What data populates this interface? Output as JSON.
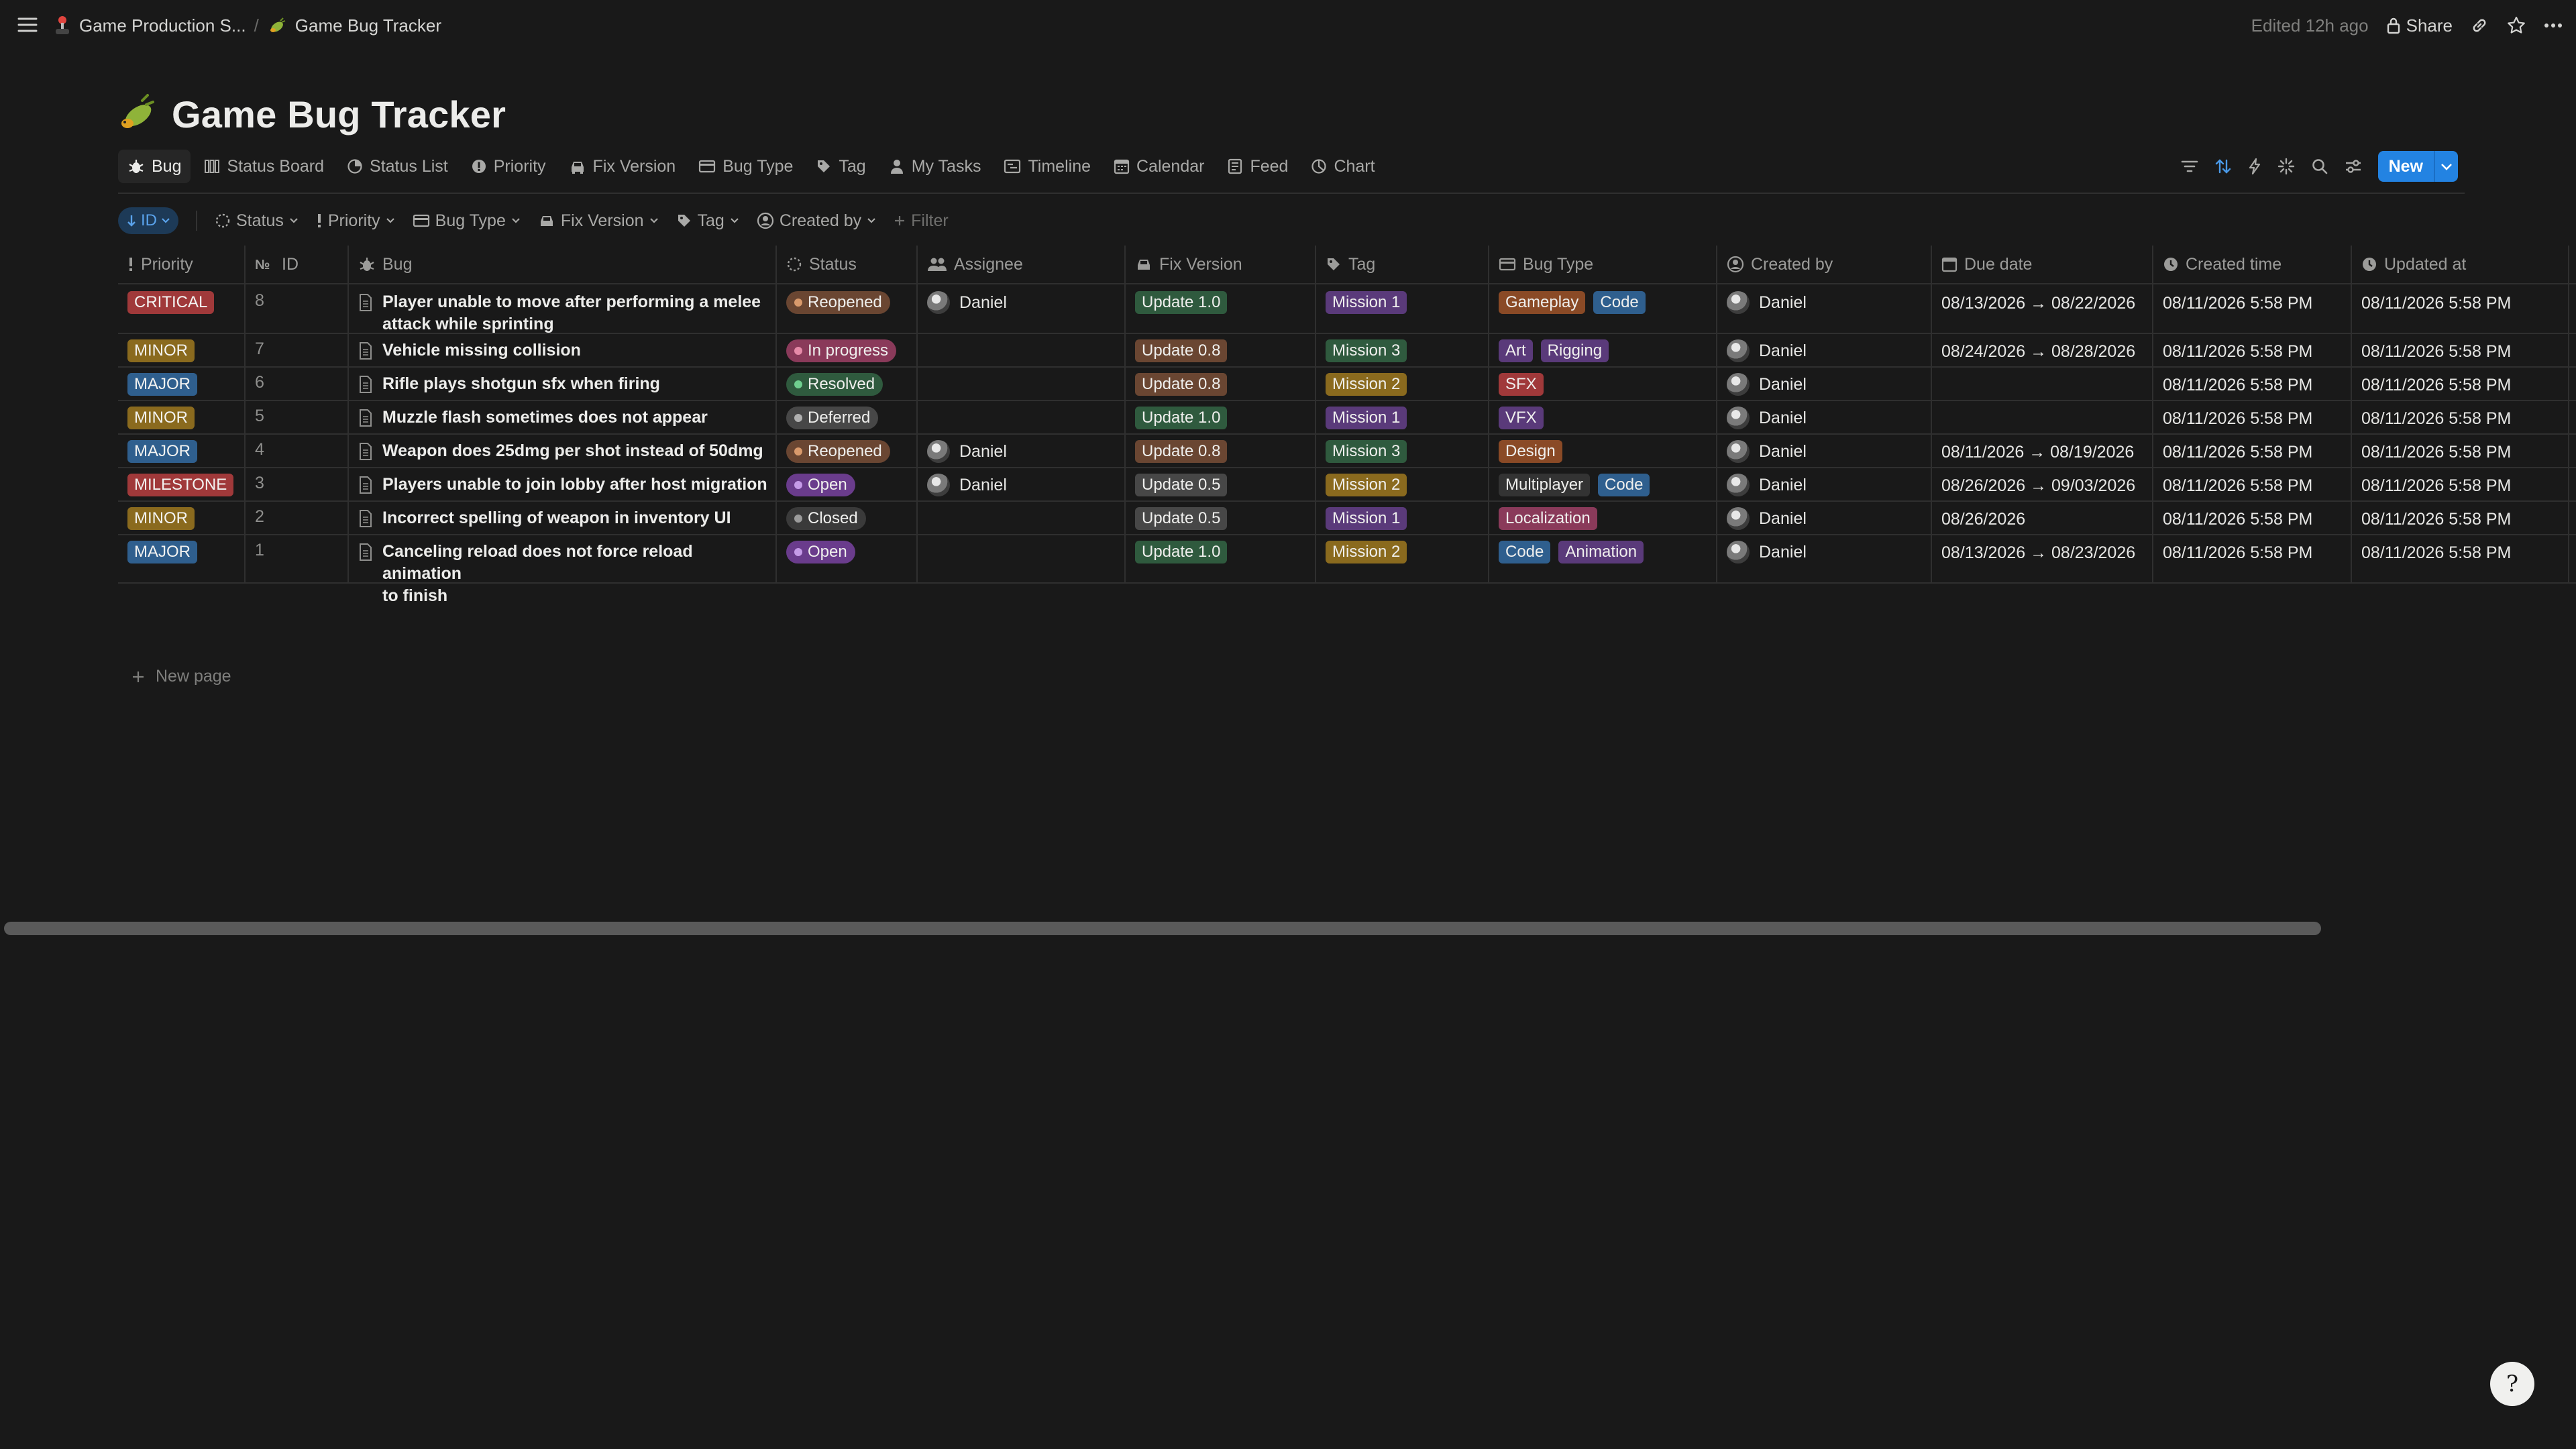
{
  "breadcrumb": [
    {
      "icon": "joystick-icon",
      "label": "Game Production S..."
    },
    {
      "icon": "bug-emoji-icon",
      "label": "Game Bug Tracker"
    }
  ],
  "topbar": {
    "edited": "Edited 12h ago",
    "share": "Share"
  },
  "page": {
    "title": "Game Bug Tracker"
  },
  "tabs": [
    "Bug",
    "Status Board",
    "Status List",
    "Priority",
    "Fix Version",
    "Bug Type",
    "Tag",
    "My Tasks",
    "Timeline",
    "Calendar",
    "Feed",
    "Chart"
  ],
  "toolbar": {
    "new_label": "New"
  },
  "filters": {
    "sort": "ID",
    "items": [
      "Status",
      "Priority",
      "Bug Type",
      "Fix Version",
      "Tag",
      "Created by"
    ],
    "add_filter": "Filter"
  },
  "columns": [
    "Priority",
    "ID",
    "Bug",
    "Status",
    "Assignee",
    "Fix Version",
    "Tag",
    "Bug Type",
    "Created by",
    "Due date",
    "Created time",
    "Updated at"
  ],
  "rows": [
    {
      "priority": "CRITICAL",
      "id": "8",
      "bug": "Player unable to move after performing a melee\nattack while sprinting",
      "status": "Reopened",
      "assignee": "Daniel",
      "fix": "Update 1.0",
      "tag": "Mission 1",
      "types": [
        "Gameplay",
        "Code"
      ],
      "created_by": "Daniel",
      "due": "08/13/2026 → 08/22/2026",
      "created": "08/11/2026 5:58 PM",
      "updated": "08/11/2026 5:58 PM"
    },
    {
      "priority": "MINOR",
      "id": "7",
      "bug": "Vehicle missing collision",
      "status": "In progress",
      "assignee": "",
      "fix": "Update 0.8",
      "tag": "Mission 3",
      "types": [
        "Art",
        "Rigging"
      ],
      "created_by": "Daniel",
      "due": "08/24/2026 → 08/28/2026",
      "created": "08/11/2026 5:58 PM",
      "updated": "08/11/2026 5:58 PM"
    },
    {
      "priority": "MAJOR",
      "id": "6",
      "bug": "Rifle plays shotgun sfx when firing",
      "status": "Resolved",
      "assignee": "",
      "fix": "Update 0.8",
      "tag": "Mission 2",
      "types": [
        "SFX"
      ],
      "created_by": "Daniel",
      "due": "",
      "created": "08/11/2026 5:58 PM",
      "updated": "08/11/2026 5:58 PM"
    },
    {
      "priority": "MINOR",
      "id": "5",
      "bug": "Muzzle flash sometimes does not appear",
      "status": "Deferred",
      "assignee": "",
      "fix": "Update 1.0",
      "tag": "Mission 1",
      "types": [
        "VFX"
      ],
      "created_by": "Daniel",
      "due": "",
      "created": "08/11/2026 5:58 PM",
      "updated": "08/11/2026 5:58 PM"
    },
    {
      "priority": "MAJOR",
      "id": "4",
      "bug": "Weapon does 25dmg per shot instead of 50dmg",
      "status": "Reopened",
      "assignee": "Daniel",
      "fix": "Update 0.8",
      "tag": "Mission 3",
      "types": [
        "Design"
      ],
      "created_by": "Daniel",
      "due": "08/11/2026 → 08/19/2026",
      "created": "08/11/2026 5:58 PM",
      "updated": "08/11/2026 5:58 PM"
    },
    {
      "priority": "MILESTONE",
      "id": "3",
      "bug": "Players unable to join lobby after host migration",
      "status": "Open",
      "assignee": "Daniel",
      "fix": "Update 0.5",
      "tag": "Mission 2",
      "types": [
        "Multiplayer",
        "Code"
      ],
      "created_by": "Daniel",
      "due": "08/26/2026 → 09/03/2026",
      "created": "08/11/2026 5:58 PM",
      "updated": "08/11/2026 5:58 PM"
    },
    {
      "priority": "MINOR",
      "id": "2",
      "bug": "Incorrect spelling of weapon in inventory UI",
      "status": "Closed",
      "assignee": "",
      "fix": "Update 0.5",
      "tag": "Mission 1",
      "types": [
        "Localization"
      ],
      "created_by": "Daniel",
      "due": "08/26/2026",
      "created": "08/11/2026 5:58 PM",
      "updated": "08/11/2026 5:58 PM"
    },
    {
      "priority": "MAJOR",
      "id": "1",
      "bug": "Canceling reload does not force reload animation\nto finish",
      "status": "Open",
      "assignee": "",
      "fix": "Update 1.0",
      "tag": "Mission 2",
      "types": [
        "Code",
        "Animation"
      ],
      "created_by": "Daniel",
      "due": "08/13/2026 → 08/23/2026",
      "created": "08/11/2026 5:58 PM",
      "updated": "08/11/2026 5:58 PM"
    }
  ],
  "new_page_label": "New page",
  "colors": {
    "priority": {
      "CRITICAL": "#a0393a",
      "MINOR": "#8a6a1e",
      "MAJOR": "#2f5f8e",
      "MILESTONE": "#a0393a"
    },
    "status": {
      "Reopened": {
        "bg": "#6a4632",
        "dot": "#d99a6c"
      },
      "In progress": {
        "bg": "#8a3a5a",
        "dot": "#e68aa8"
      },
      "Resolved": {
        "bg": "#2f5a3e",
        "dot": "#6fcf8f"
      },
      "Deferred": {
        "bg": "#474747",
        "dot": "#b0b0b0"
      },
      "Open": {
        "bg": "#6a3c8c",
        "dot": "#c59be8"
      },
      "Closed": {
        "bg": "#3a3a3a",
        "dot": "#9b9b9b"
      }
    },
    "fix": {
      "Update 1.0": "#2f5a3e",
      "Update 0.8": "#6a4632",
      "Update 0.5": "#474747"
    },
    "tag": {
      "Mission 1": "#5a3a7a",
      "Mission 3": "#2f5a3e",
      "Mission 2": "#8a6a1e"
    },
    "type": {
      "Gameplay": "#8a4a26",
      "Code": "#2f5f8e",
      "Art": "#5a3a7a",
      "Rigging": "#5a3a7a",
      "SFX": "#a0393a",
      "VFX": "#5a3a7a",
      "Design": "#8a4a26",
      "Multiplayer": "#333333",
      "Localization": "#8a3a5a",
      "Animation": "#5a3a7a"
    }
  }
}
